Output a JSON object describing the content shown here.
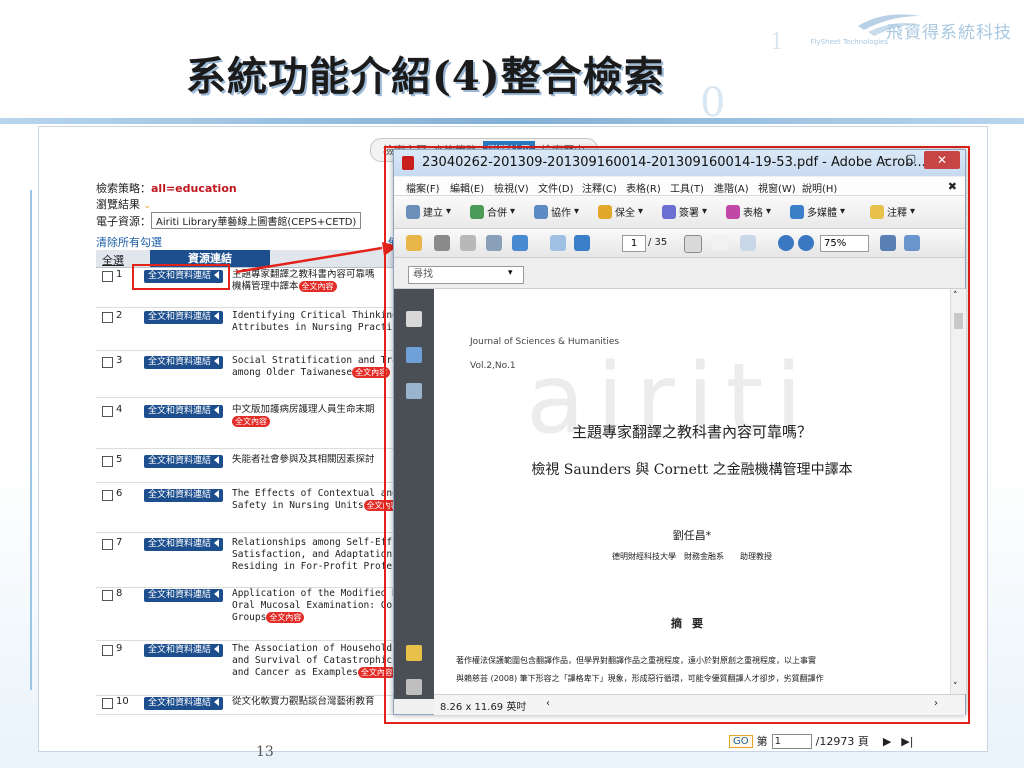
{
  "slide": {
    "title": "系統功能介紹(4)整合檢索",
    "page_number": "13",
    "logo_text": "飛資得系統科技",
    "logo_sub": "FlySheet Technologies"
  },
  "web": {
    "tabs": [
      "檢索主頁",
      "查詢策略",
      "瀏覽結果",
      "檢索歷史"
    ],
    "strategy_label": "檢索策略：",
    "strategy_value": "all=education",
    "browse_label": "瀏覽結果",
    "source_label": "電子資源：",
    "source_value": "Airiti Library華藝線上圖書館(CEPS+CETD)",
    "clear_link": "清除所有勾選",
    "ctl_partial": "備",
    "col_all": "全選",
    "col_source": "資源連結",
    "fulltext_btn": "全文和資料連結",
    "fulltext_badge": "全文內容",
    "results": [
      {
        "num": "1",
        "line1": "主題專家翻譯之教科書內容可靠嗎",
        "line2": "機構管理中譯本"
      },
      {
        "num": "2",
        "line1": "Identifying Critical Thinking In",
        "line2": "Attributes in Nursing Practice"
      },
      {
        "num": "3",
        "line1": "Social Stratification and Traj",
        "line2": "among Older Taiwanese"
      },
      {
        "num": "4",
        "line1": "中文版加護病房護理人員生命末期",
        "line2": ""
      },
      {
        "num": "5",
        "line1": "失能者社會參與及其相關因素探討",
        "line2": ""
      },
      {
        "num": "6",
        "line1": "The Effects of Contextual and",
        "line2": "Safety in Nursing Units"
      },
      {
        "num": "7",
        "line1": "Relationships among Self-Effi",
        "line2": "Satisfaction, and Adaptation",
        "line3": "Residing in For-Profit Profess"
      },
      {
        "num": "8",
        "line1": "Application of the Modified H",
        "line2": "Oral Mucosal Examination: Co",
        "line3": "Groups"
      },
      {
        "num": "9",
        "line1": "The Association of Household",
        "line2": "and Survival of Catastrophic",
        "line3": "and Cancer as Examples"
      },
      {
        "num": "10",
        "line1": "從文化軟實力觀點談台灣藝術教育",
        "line2": ""
      }
    ],
    "pager": {
      "go": "GO",
      "prefix": "第",
      "page": "1",
      "total": "/12973 頁",
      "next": "▶",
      "last": "▶|"
    }
  },
  "pdf": {
    "title": "23040262-201309-201309160014-201309160014-19-53.pdf - Adobe Acrob...",
    "menu": [
      "檔案(F)",
      "編輯(E)",
      "檢視(V)",
      "文件(D)",
      "注釋(C)",
      "表格(R)",
      "工具(T)",
      "進階(A)",
      "視窗(W)",
      "說明(H)"
    ],
    "tools": [
      "建立",
      "合併",
      "協作",
      "保全",
      "簽署",
      "表格",
      "多媒體",
      "注釋"
    ],
    "page": "1",
    "page_total": "/ 35",
    "zoom": "75%",
    "find_placeholder": "尋找",
    "status_size": "8.26 x 11.69 英吋",
    "doc": {
      "watermark": "airiti",
      "journal": "Journal of Sciences & Humanities",
      "volume": "Vol.2,No.1",
      "title1": "主題專家翻譯之教科書內容可靠嗎？",
      "title2": "檢視 Saunders  與 Cornett 之金融機構管理中譯本",
      "author": "劉任昌*",
      "affiliation": "德明財經科技大學　財務金融系　　助理教授",
      "abstract_heading": "摘要",
      "abstract_line1": "著作權法保護範圍包含翻譯作品，但學界對翻譯作品之重視程度，遠小於對原創之重視程度，以上事實",
      "abstract_line2": "與賴慈芸 (2008) 筆下形容之「譯格卑下」現象，形成惡行循環，可能令優質翻譯人才卻步，劣質翻譯作"
    }
  },
  "colors": {
    "accent_blue": "#1d4f8f",
    "highlight_red": "#e3231b",
    "badge_red": "#e22d28"
  }
}
